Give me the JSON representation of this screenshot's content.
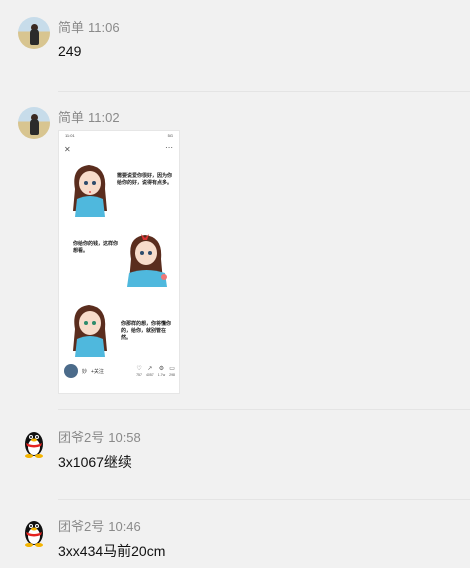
{
  "messages": [
    {
      "sender": "简单",
      "time": "11:06",
      "text": "249",
      "avatar": "landscape-avatar"
    },
    {
      "sender": "简单",
      "time": "11:02",
      "avatar": "landscape-avatar",
      "image": {
        "status_time": "11:01",
        "status_right": "5G",
        "panel1": "需要说爱你很好，因为你给你的好，说得有点多。",
        "panel2": "你给你的钱，这样你想看。",
        "panel3": "你那样的想，你将懂你的，给你，就别管在然。",
        "author": "妙",
        "follow": "+关注",
        "stats": [
          "757",
          "4057",
          "1.7w",
          "298"
        ]
      }
    },
    {
      "sender": "团爷2号",
      "time": "10:58",
      "text": "3x1067继续",
      "avatar": "penguin-avatar"
    },
    {
      "sender": "团爷2号",
      "time": "10:46",
      "text": "3xx434马前20cm",
      "avatar": "penguin-avatar"
    }
  ],
  "colors": {
    "background": "#f1f1f1",
    "meta": "#8a8a8a",
    "text": "#111111"
  }
}
